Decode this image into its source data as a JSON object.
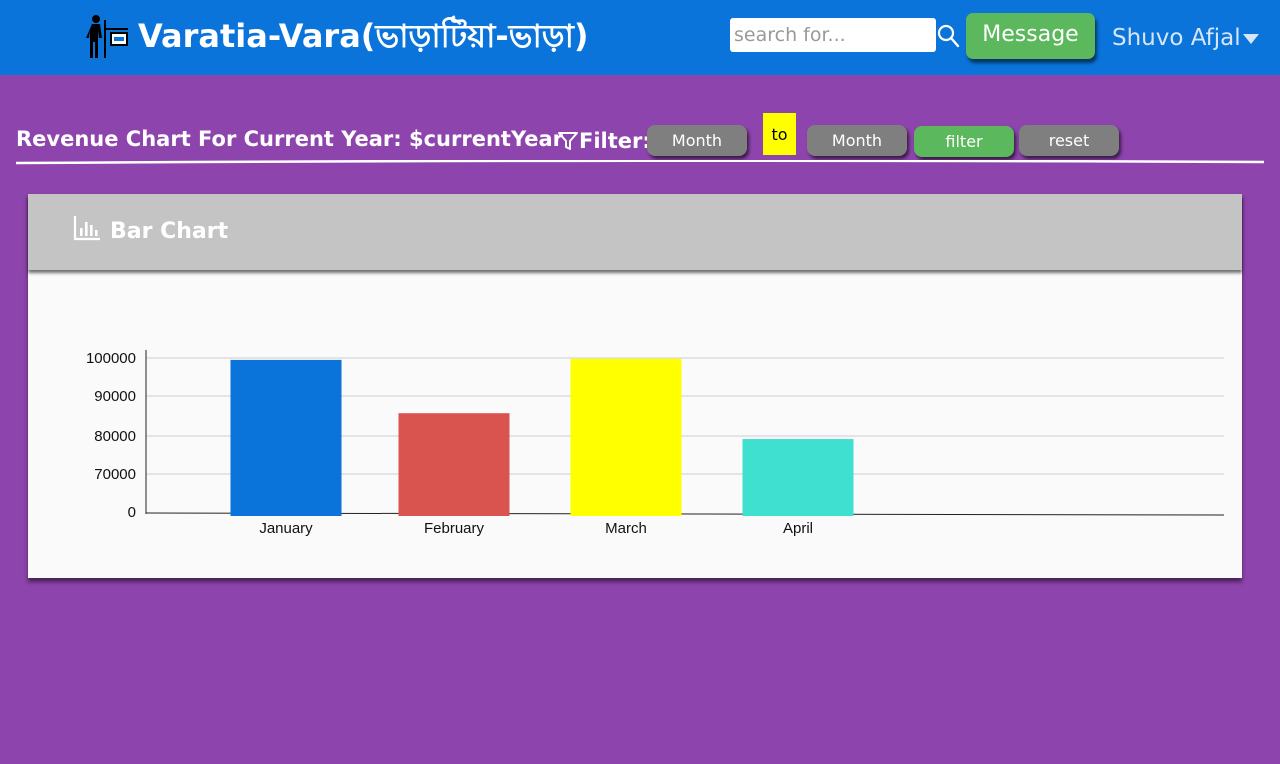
{
  "header": {
    "brand": "Varatia-Vara(ভাড়াটিয়া-ভাড়া)",
    "logo_icon": "landlord-rent-sign-icon",
    "search_placeholder": "search for...",
    "search_icon": "search-icon",
    "message_label": "Message",
    "user_name": "Shuvo Afjal",
    "caret_icon": "caret-down-icon"
  },
  "toolbar": {
    "title": "Revenue Chart For Current Year: $currentYear",
    "filter_icon": "funnel-icon",
    "filter_label": "Filter:",
    "from_label": "Month",
    "to_label": "to",
    "to_month_label": "Month",
    "filter_button": "filter",
    "reset_button": "reset"
  },
  "card": {
    "icon": "bar-chart-icon",
    "title": "Bar Chart"
  },
  "colors": {
    "topbar": "#0a74da",
    "page_bg": "#8e44ad",
    "green": "#5cb85c",
    "gray_pill": "#7f7f7f",
    "highlight": "#ffff00"
  },
  "chart_data": {
    "type": "bar",
    "categories": [
      "January",
      "February",
      "March",
      "April"
    ],
    "values": [
      99500,
      85700,
      99800,
      79200
    ],
    "colors": [
      "#0a74da",
      "#d9534f",
      "#ffff00",
      "#40e0d0"
    ],
    "ytick_labels": [
      "0",
      "70000",
      "80000",
      "90000",
      "100000"
    ],
    "ytick_values": [
      0,
      70000,
      80000,
      90000,
      100000
    ],
    "grid": true,
    "legend": "none"
  }
}
